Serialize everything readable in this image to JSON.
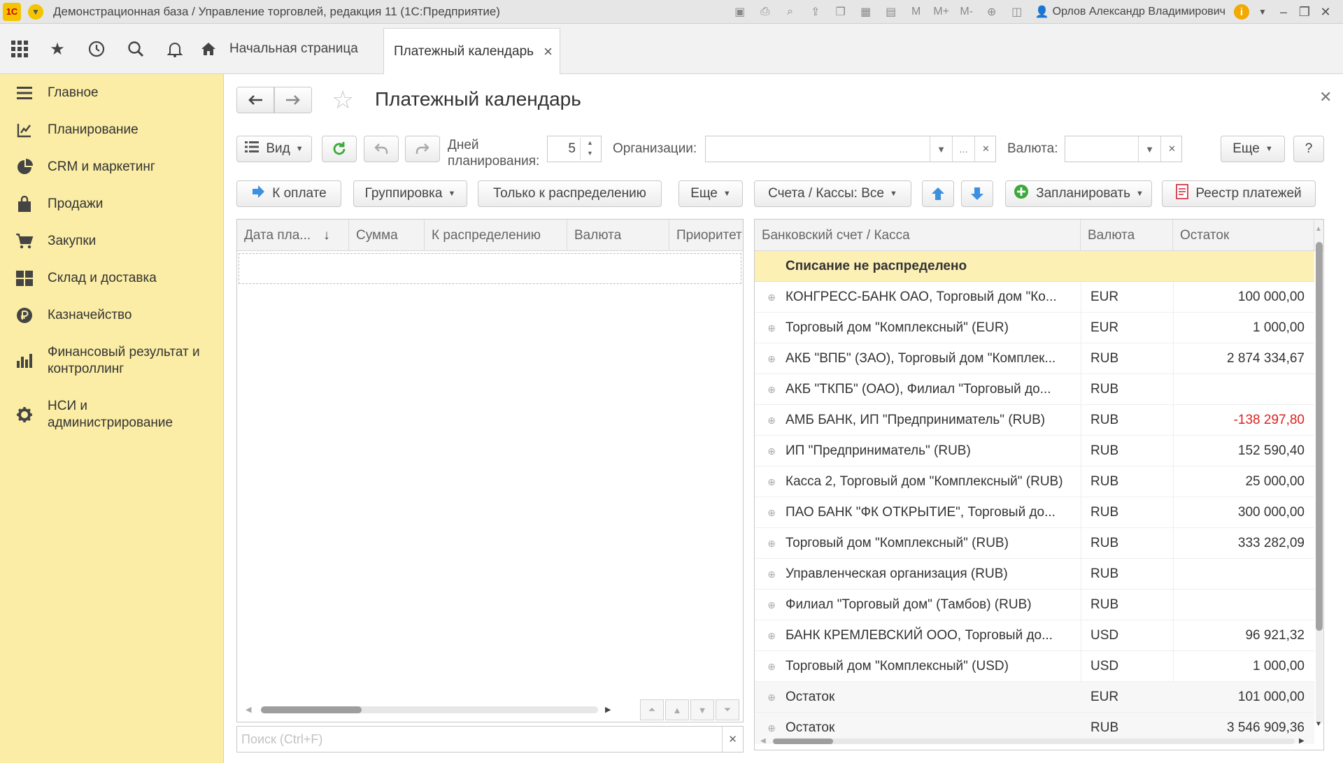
{
  "window": {
    "logo": "1С",
    "title": "Демонстрационная база / Управление торговлей, редакция 11  (1С:Предприятие)",
    "user": "Орлов Александр Владимирович",
    "calc_m": "M",
    "calc_mplus": "M+",
    "calc_mminus": "M-"
  },
  "tabs": {
    "home": "Начальная страница",
    "active": "Платежный календарь"
  },
  "sidebar": {
    "items": [
      {
        "label": "Главное",
        "icon": "menu-lines-icon"
      },
      {
        "label": "Планирование",
        "icon": "planning-icon"
      },
      {
        "label": "CRM и маркетинг",
        "icon": "pie-chart-icon"
      },
      {
        "label": "Продажи",
        "icon": "bag-icon"
      },
      {
        "label": "Закупки",
        "icon": "cart-icon"
      },
      {
        "label": "Склад и доставка",
        "icon": "grid-icon"
      },
      {
        "label": "Казначейство",
        "icon": "coin-icon"
      },
      {
        "label": "Финансовый результат и контроллинг",
        "icon": "bar-chart-icon"
      },
      {
        "label": "НСИ и администрирование",
        "icon": "gear-icon"
      }
    ]
  },
  "form": {
    "title": "Платежный календарь",
    "toolbar1": {
      "view": "Вид",
      "days_label": "Дней планирования:",
      "days_value": "5",
      "org_label": "Организации:",
      "org_value": "",
      "currency_label": "Валюта:",
      "currency_value": "",
      "more": "Еще",
      "help": "?"
    },
    "toolbar2": {
      "to_pay": "К оплате",
      "grouping": "Группировка",
      "only_dist": "Только к распределению",
      "more": "Еще",
      "accounts": "Счета / Кассы: Все",
      "plan": "Запланировать",
      "registry": "Реестр платежей"
    },
    "left_table": {
      "columns": [
        "Дата пла...",
        "Сумма",
        "К распределению",
        "Валюта",
        "Приоритет"
      ],
      "sort_mark": "↓"
    },
    "search": {
      "placeholder": "Поиск (Ctrl+F)"
    },
    "right_table": {
      "columns": [
        "Банковский счет / Касса",
        "Валюта",
        "Остаток"
      ],
      "highlight": "Списание не распределено",
      "rows": [
        {
          "account": "КОНГРЕСС-БАНК ОАО, Торговый дом \"Ко...",
          "currency": "EUR",
          "balance": "100 000,00",
          "negative": false
        },
        {
          "account": "Торговый дом \"Комплексный\" (EUR)",
          "currency": "EUR",
          "balance": "1 000,00",
          "negative": false
        },
        {
          "account": "АКБ \"ВПБ\" (ЗАО), Торговый дом \"Комплек...",
          "currency": "RUB",
          "balance": "2 874 334,67",
          "negative": false
        },
        {
          "account": "АКБ \"ТКПБ\" (ОАО), Филиал \"Торговый до...",
          "currency": "RUB",
          "balance": "",
          "negative": false
        },
        {
          "account": "АМБ БАНК, ИП \"Предприниматель\" (RUB)",
          "currency": "RUB",
          "balance": "-138 297,80",
          "negative": true
        },
        {
          "account": "ИП \"Предприниматель\" (RUB)",
          "currency": "RUB",
          "balance": "152 590,40",
          "negative": false
        },
        {
          "account": "Касса 2, Торговый дом \"Комплексный\" (RUB)",
          "currency": "RUB",
          "balance": "25 000,00",
          "negative": false
        },
        {
          "account": "ПАО БАНК \"ФК ОТКРЫТИЕ\", Торговый до...",
          "currency": "RUB",
          "balance": "300 000,00",
          "negative": false
        },
        {
          "account": "Торговый дом \"Комплексный\" (RUB)",
          "currency": "RUB",
          "balance": "333 282,09",
          "negative": false
        },
        {
          "account": "Управленческая организация (RUB)",
          "currency": "RUB",
          "balance": "",
          "negative": false
        },
        {
          "account": "Филиал \"Торговый дом\" (Тамбов) (RUB)",
          "currency": "RUB",
          "balance": "",
          "negative": false
        },
        {
          "account": "БАНК КРЕМЛЕВСКИЙ ООО, Торговый до...",
          "currency": "USD",
          "balance": "96 921,32",
          "negative": false
        },
        {
          "account": "Торговый дом \"Комплексный\" (USD)",
          "currency": "USD",
          "balance": "1 000,00",
          "negative": false
        }
      ],
      "totals": [
        {
          "account": "Остаток",
          "currency": "EUR",
          "balance": "101 000,00"
        },
        {
          "account": "Остаток",
          "currency": "RUB",
          "balance": "3 546 909,36"
        }
      ]
    }
  },
  "colors": {
    "sidebar_bg": "#fbeda5",
    "highlight_bg": "#fdf0b5",
    "negative": "#e02020",
    "accent_blue": "#3d8fe0",
    "accent_green": "#3aaa3a"
  }
}
